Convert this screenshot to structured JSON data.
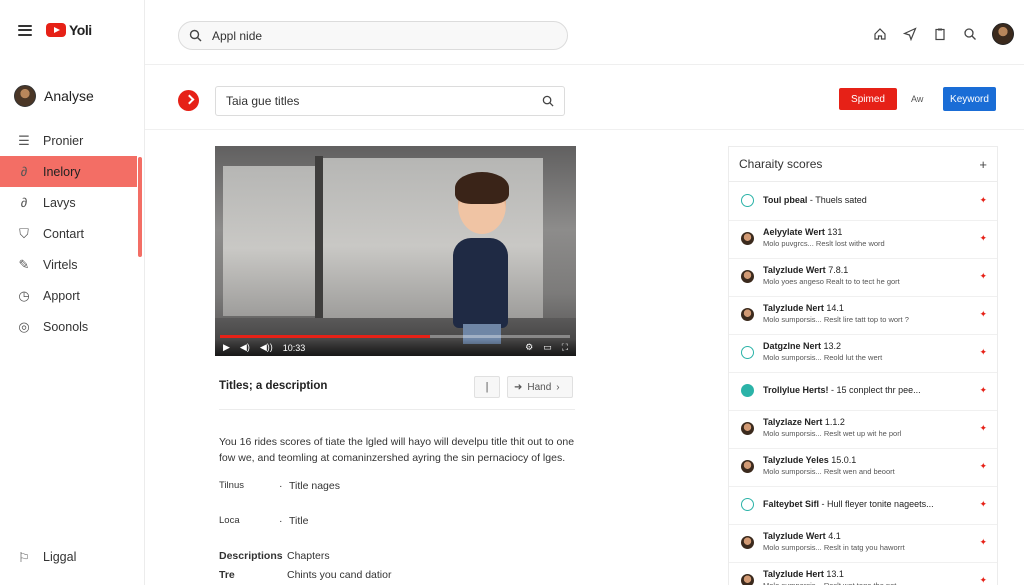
{
  "app": {
    "logo_text": "Yoli"
  },
  "sidebar": {
    "channel_name": "Analyse",
    "items": [
      {
        "label": "Pronier",
        "icon": "list-icon",
        "glyph": "☰"
      },
      {
        "label": "Inelory",
        "icon": "link-icon",
        "glyph": "∂",
        "active": true
      },
      {
        "label": "Lavys",
        "icon": "link-icon",
        "glyph": "∂"
      },
      {
        "label": "Contart",
        "icon": "shield-icon",
        "glyph": "⛉"
      },
      {
        "label": "Virtels",
        "icon": "pen-icon",
        "glyph": "✎"
      },
      {
        "label": "Apport",
        "icon": "clock-icon",
        "glyph": "◷"
      },
      {
        "label": "Soonols",
        "icon": "circle-icon",
        "glyph": "◎"
      }
    ],
    "bottom_label": "Liggal"
  },
  "search": {
    "value": "Appl nide"
  },
  "toolbar": {
    "title_input_value": "Taia gue titles",
    "primary_button": "Spimed",
    "aw_label": "Aw",
    "keyword_button": "Keyword"
  },
  "player": {
    "time": "10:33",
    "progress": 0.6
  },
  "details": {
    "title": "Titles; a description",
    "pill1_label": "|",
    "pill2_label": "Hand",
    "description": "You 16 rides scores of tiate the lgled will hayo will develpu title thit out to one fow we, and teomling at comaninzershed ayring the sin pernaciocy of lges.",
    "rows": [
      {
        "label": "Tilnus",
        "value": "Title nages"
      },
      {
        "label": "Loca",
        "value": "Title"
      }
    ],
    "descriptions_label": "Descriptions",
    "chapters_label": "Chapters",
    "tre_label": "Tre",
    "tre_value": "Chints you cand datior"
  },
  "panel": {
    "title": "Charaity scores",
    "items": [
      {
        "icon": "teal",
        "name": "Toul pbeal",
        "note": "- Thuels sated",
        "sub": ""
      },
      {
        "icon": "face",
        "name": "Aelyylate Wert",
        "note": "131",
        "sub": "Molo puvgrcs... Reslt lost withe word"
      },
      {
        "icon": "face",
        "name": "Talyzlude Wert",
        "note": "7.8.1",
        "sub": "Molo yoes angeso Realt to to tect he gort"
      },
      {
        "icon": "face",
        "name": "Talyzlude Nert",
        "note": "14.1",
        "sub": "Molo sumporsis... Reslt lire tatt top to wort ?"
      },
      {
        "icon": "teal",
        "name": "Datgzlne Nert",
        "note": "13.2",
        "sub": "Molo sumporsis... Reold lut the wert"
      },
      {
        "icon": "teal-fill",
        "name": "Trollylue Herts!",
        "note": "- 15 conplect thr pee...",
        "sub": ""
      },
      {
        "icon": "face",
        "name": "Talyzlaze Nert",
        "note": "1.1.2",
        "sub": "Molo sumporsis... Reslt wet up wit he porl"
      },
      {
        "icon": "face",
        "name": "Talyzlude Yeles",
        "note": "15.0.1",
        "sub": "Molo sumporsis... Reslt wen and beoort"
      },
      {
        "icon": "teal",
        "name": "Falteybet Sifl",
        "note": "- Hull fleyer tonite nageets...",
        "sub": ""
      },
      {
        "icon": "face",
        "name": "Talyzlude Wert",
        "note": "4.1",
        "sub": "Molo sumporsis... Reslt in tatg you haworrt"
      },
      {
        "icon": "face",
        "name": "Talyzlude Hert",
        "note": "13.1",
        "sub": "Molo sumporsis... Reslt wet toge the pet."
      }
    ]
  },
  "colors": {
    "accent_red": "#e62117",
    "active_nav": "#f36e65",
    "keyword_blue": "#1a6dd6",
    "teal": "#2bb3a8"
  }
}
